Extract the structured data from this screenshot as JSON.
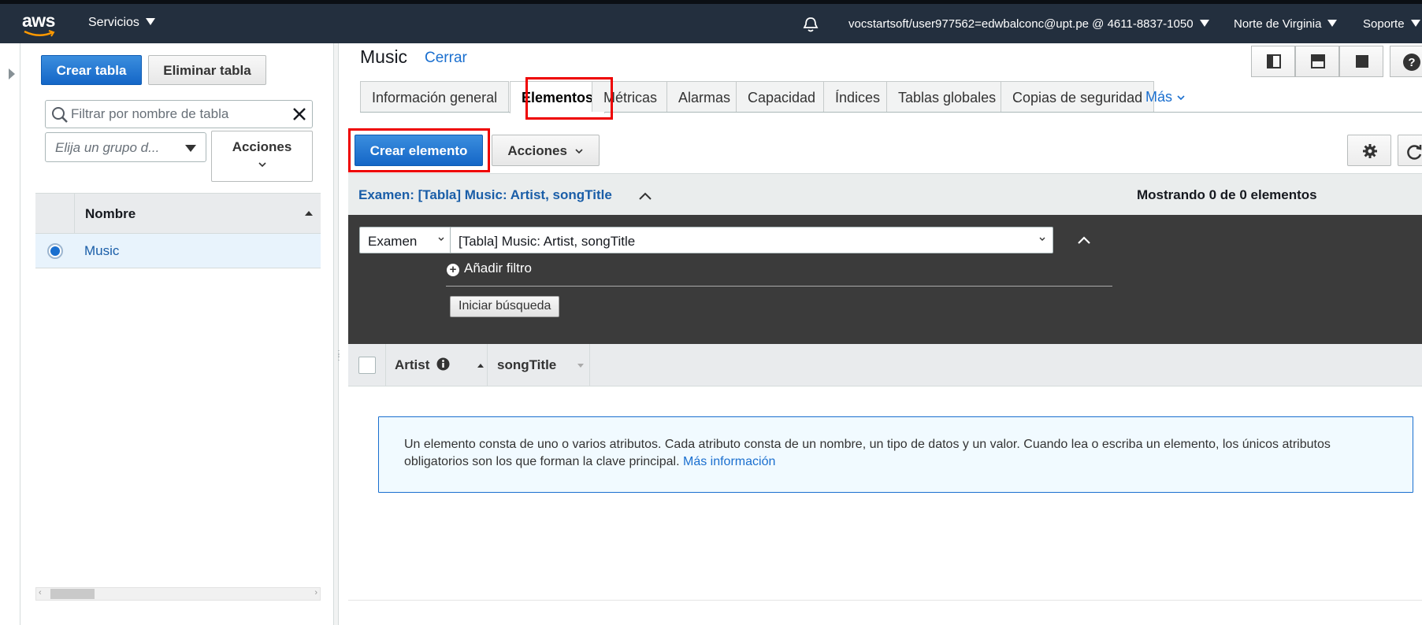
{
  "topbar": {
    "logo_text": "aws",
    "services": "Servicios",
    "account": "vocstartsoft/user977562=edwbalconc@upt.pe @ 4611-8837-1050",
    "region": "Norte de Virginia",
    "support": "Soporte"
  },
  "sidebar": {
    "create_table": "Crear tabla",
    "delete_table": "Eliminar tabla",
    "filter_placeholder": "Filtrar por nombre de tabla",
    "group_placeholder": "Elija un grupo d...",
    "actions": "Acciones",
    "table_header": "Nombre",
    "tables": [
      {
        "name": "Music",
        "selected": true
      }
    ]
  },
  "main": {
    "table_title": "Music",
    "close": "Cerrar",
    "tabs": [
      "Información general",
      "Elementos",
      "Métricas",
      "Alarmas",
      "Capacidad",
      "Índices",
      "Tablas globales",
      "Copias de seguridad"
    ],
    "active_tab": "Elementos",
    "more": "Más",
    "create_item": "Crear elemento",
    "actions": "Acciones",
    "scan_summary": "Examen: [Tabla] Music: Artist, songTitle",
    "count_text": "Mostrando 0 de 0 elementos",
    "scan_mode": "Examen",
    "scan_target": "[Tabla] Music: Artist, songTitle",
    "add_filter": "Añadir filtro",
    "start_search": "Iniciar búsqueda",
    "columns": [
      "Artist",
      "songTitle"
    ],
    "info_text": "Un elemento consta de uno o varios atributos. Cada atributo consta de un nombre, un tipo de datos y un valor. Cuando lea o escriba un elemento, los únicos atributos obligatorios son los que forman la clave principal.",
    "info_link": "Más información"
  },
  "colors": {
    "topbar_bg": "#232f3e",
    "primary": "#1466c7",
    "link": "#1a6fcf",
    "highlight": "#e00000"
  }
}
